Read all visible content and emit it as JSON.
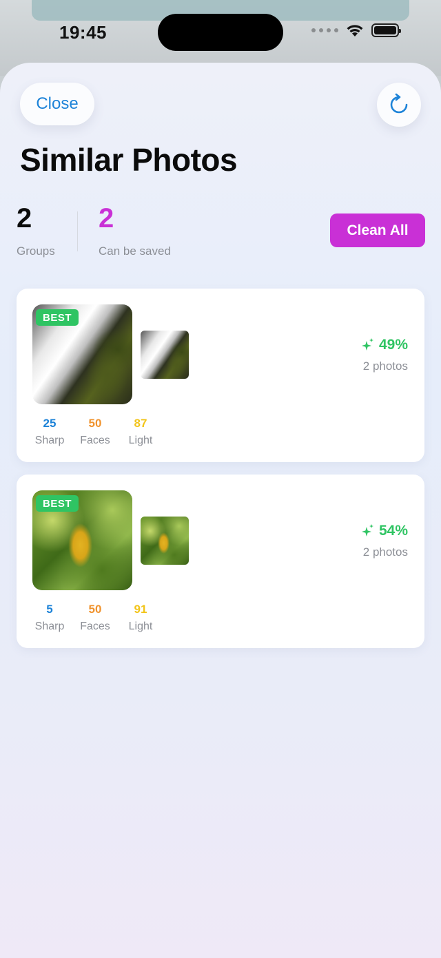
{
  "status_bar": {
    "time": "19:45"
  },
  "header": {
    "close_label": "Close",
    "title": "Similar Photos",
    "refresh_icon": "refresh-icon"
  },
  "summary": {
    "groups_value": "2",
    "groups_label": "Groups",
    "saved_value": "2",
    "saved_label": "Can be saved",
    "clean_all_label": "Clean All"
  },
  "groups": [
    {
      "best_label": "BEST",
      "similarity": "49%",
      "photo_count": "2 photos",
      "metrics": {
        "sharp_value": "25",
        "sharp_label": "Sharp",
        "faces_value": "50",
        "faces_label": "Faces",
        "light_value": "87",
        "light_label": "Light"
      }
    },
    {
      "best_label": "BEST",
      "similarity": "54%",
      "photo_count": "2 photos",
      "metrics": {
        "sharp_value": "5",
        "sharp_label": "Sharp",
        "faces_value": "50",
        "faces_label": "Faces",
        "light_value": "91",
        "light_label": "Light"
      }
    }
  ],
  "colors": {
    "accent_blue": "#1d83d8",
    "accent_magenta": "#c930d6",
    "success_green": "#2fc463",
    "faces_orange": "#f0932e",
    "light_yellow": "#f2c418"
  }
}
